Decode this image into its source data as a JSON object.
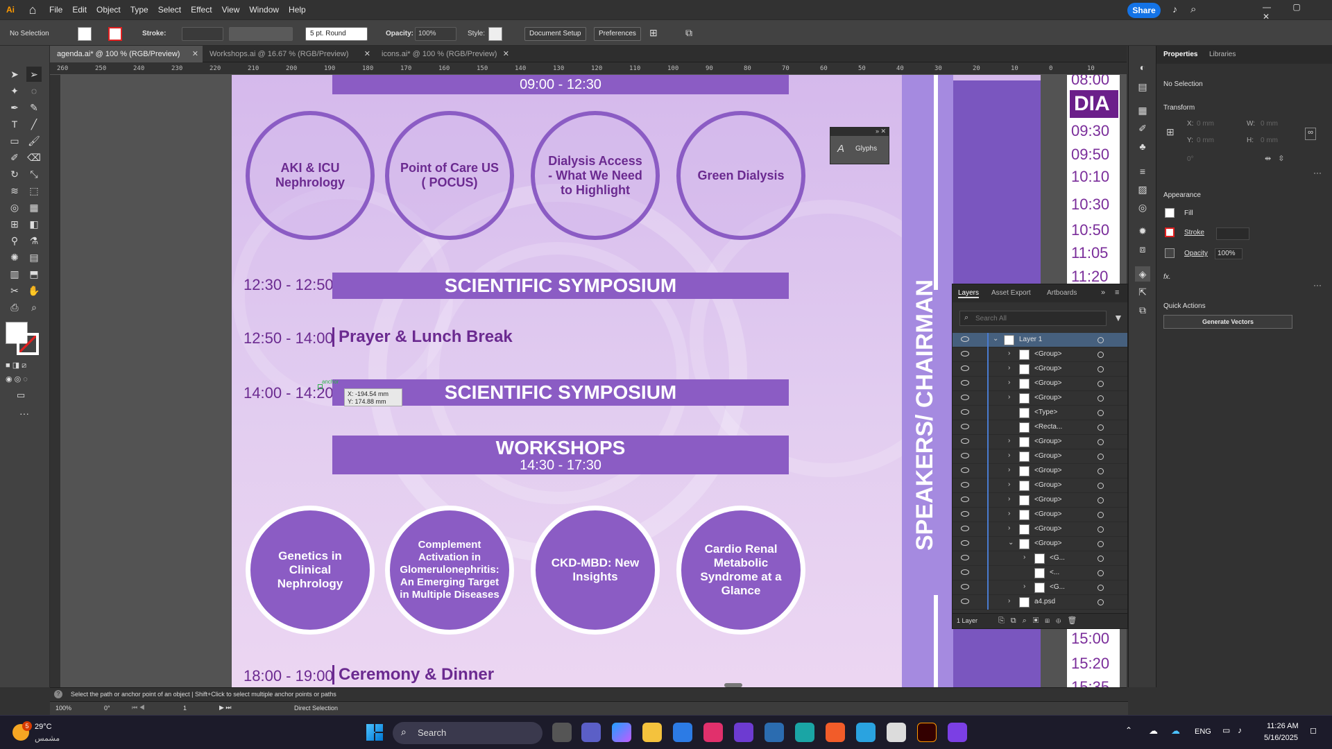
{
  "menu": [
    "File",
    "Edit",
    "Object",
    "Type",
    "Select",
    "Effect",
    "View",
    "Window",
    "Help"
  ],
  "share_label": "Share",
  "control": {
    "selection": "No Selection",
    "stroke_label": "Stroke:",
    "brush": "5 pt. Round",
    "opacity_label": "Opacity:",
    "opacity": "100%",
    "style_label": "Style:",
    "doc_setup": "Document Setup",
    "preferences": "Preferences"
  },
  "tabs": [
    {
      "label": "agenda.ai* @ 100 % (RGB/Preview)"
    },
    {
      "label": "Workshops.ai @ 16.67 % (RGB/Preview)"
    },
    {
      "label": "icons.ai* @ 100 % (RGB/Preview)"
    }
  ],
  "ruler_h": [
    "260",
    "250",
    "240",
    "230",
    "220",
    "210",
    "200",
    "190",
    "180",
    "170",
    "160",
    "150",
    "140",
    "130",
    "120",
    "110",
    "100",
    "90",
    "80",
    "70",
    "60",
    "50",
    "40",
    "30",
    "20",
    "10",
    "0",
    "10"
  ],
  "art": {
    "top_time": "09:00 - 12:30",
    "circles_top": [
      "AKI & ICU Nephrology",
      "Point of Care US ( POCUS)",
      "Dialysis Access - What We Need to Highlight",
      "Green Dialysis"
    ],
    "t1": "12:30 - 12:50",
    "sym1": "SCIENTIFIC SYMPOSIUM",
    "t2": "12:50 - 14:00",
    "lunch": "Prayer & Lunch Break",
    "t3": "14:00 - 14:20",
    "sym2": "SCIENTIFIC SYMPOSIUM",
    "anchor": "anchor",
    "tooltip_x": "X: -194.54 mm",
    "tooltip_y": "Y: 174.88 mm",
    "workshops": "WORKSHOPS",
    "workshops_time": "14:30 - 17:30",
    "circles_bot": [
      "Genetics in Clinical Nephrology",
      "Complement Activation in Glomerulonephritis: An Emerging Target in Multiple Diseases",
      "CKD-MBD: New Insights",
      "Cardio Renal Metabolic Syndrome at a Glance"
    ],
    "t4": "18:00 - 19:00",
    "ceremony": "Ceremony & Dinner",
    "vertical": "SPEAKERS/ CHAIRMAN"
  },
  "art2": {
    "head": "DIA",
    "top": "08:00",
    "times": [
      "09:30",
      "09:50",
      "10:10",
      "10:30",
      "10:50",
      "11:05",
      "11:20"
    ],
    "bottom": [
      "15:00",
      "15:20",
      "15:35"
    ]
  },
  "glyphs_label": "Glyphs",
  "layers": {
    "tabs": [
      "Layers",
      "Asset Export",
      "Artboards"
    ],
    "search_placeholder": "Search All",
    "rows": [
      {
        "name": "Layer 1",
        "indent": 0,
        "chev": "v",
        "sel": true
      },
      {
        "name": "<Group>",
        "indent": 1,
        "chev": ">"
      },
      {
        "name": "<Group>",
        "indent": 1,
        "chev": ">"
      },
      {
        "name": "<Group>",
        "indent": 1,
        "chev": ">"
      },
      {
        "name": "<Group>",
        "indent": 1,
        "chev": ">"
      },
      {
        "name": "<Type>",
        "indent": 1,
        "chev": ""
      },
      {
        "name": "<Recta...",
        "indent": 1,
        "chev": ""
      },
      {
        "name": "<Group>",
        "indent": 1,
        "chev": ">"
      },
      {
        "name": "<Group>",
        "indent": 1,
        "chev": ">"
      },
      {
        "name": "<Group>",
        "indent": 1,
        "chev": ">"
      },
      {
        "name": "<Group>",
        "indent": 1,
        "chev": ">"
      },
      {
        "name": "<Group>",
        "indent": 1,
        "chev": ">"
      },
      {
        "name": "<Group>",
        "indent": 1,
        "chev": ">"
      },
      {
        "name": "<Group>",
        "indent": 1,
        "chev": ">"
      },
      {
        "name": "<Group>",
        "indent": 1,
        "chev": "v"
      },
      {
        "name": "<G...",
        "indent": 2,
        "chev": ">"
      },
      {
        "name": "<...",
        "indent": 2,
        "chev": ""
      },
      {
        "name": "<G...",
        "indent": 2,
        "chev": ">"
      },
      {
        "name": "a4.psd",
        "indent": 1,
        "chev": ">"
      }
    ],
    "footer": "1 Layer"
  },
  "props": {
    "tab1": "Properties",
    "tab2": "Libraries",
    "selection": "No Selection",
    "transform": "Transform",
    "x": "X:",
    "y": "Y:",
    "w": "W:",
    "h": "H:",
    "xval": "0 mm",
    "yval": "0 mm",
    "wval": "0 mm",
    "hval": "0 mm",
    "angle": "0°",
    "appearance": "Appearance",
    "fill": "Fill",
    "stroke": "Stroke",
    "opacity": "Opacity",
    "opacity_val": "100%",
    "fx": "fx.",
    "quick": "Quick Actions",
    "gen": "Generate Vectors"
  },
  "status": {
    "hint": "Select the path or anchor point of an object  |  Shift+Click to select multiple anchor points or paths",
    "zoom": "100%",
    "rotate": "0°",
    "page": "1",
    "tool": "Direct Selection"
  },
  "taskbar": {
    "weather_temp": "29°C",
    "weather_desc": "مشمس",
    "search": "Search",
    "lang": "ENG",
    "time": "11:26 AM",
    "date": "5/16/2025",
    "badge": "5"
  },
  "colors": {
    "accent": "#8b5cc4",
    "brand": "#6b2a90",
    "share": "#1473e6"
  }
}
